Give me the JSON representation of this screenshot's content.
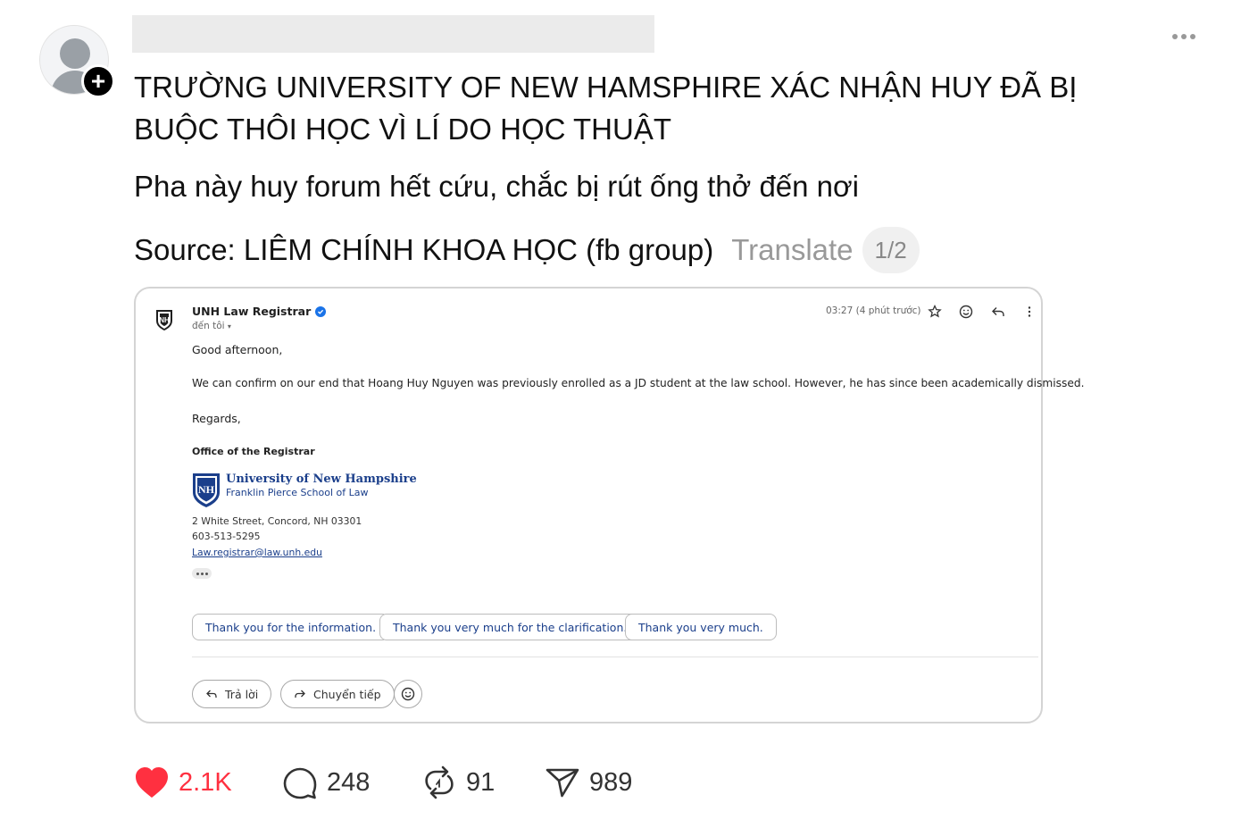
{
  "post": {
    "headline": "TRƯỜNG UNIVERSITY OF NEW HAMSPHIRE XÁC NHẬN HUY ĐÃ BỊ BUỘC THÔI HỌC VÌ LÍ DO HỌC THUẬT",
    "line2": "Pha này huy forum hết cứu, chắc bị rút ống thở đến nơi",
    "source": "Source: LIÊM CHÍNH KHOA HỌC (fb group)",
    "translate": "Translate",
    "pager": "1/2"
  },
  "email": {
    "sender": "UNH Law Registrar",
    "to": "đến tôi",
    "time": "03:27 (4 phút trước)",
    "greeting": "Good afternoon,",
    "body": "We can confirm on our end that Hoang Huy Nguyen was previously enrolled as a JD student at the law school. However, he has since been academically dismissed.",
    "regards": "Regards,",
    "office": "Office of the Registrar",
    "university": "University of New Hampshire",
    "school": "Franklin Pierce School of Law",
    "address": "2 White Street, Concord, NH  03301",
    "phone": "603-513-5295",
    "email_address": "Law.registrar@law.unh.edu",
    "smart_replies": [
      "Thank you for the information.",
      "Thank you very much for the clarification.",
      "Thank you very much."
    ],
    "reply": "Trả lời",
    "forward": "Chuyển tiếp"
  },
  "actions": {
    "likes": "2.1K",
    "comments": "248",
    "reposts": "91",
    "shares": "989"
  },
  "colors": {
    "like": "#ff3040",
    "link": "#1b3f8b",
    "verified": "#1a73e8"
  }
}
